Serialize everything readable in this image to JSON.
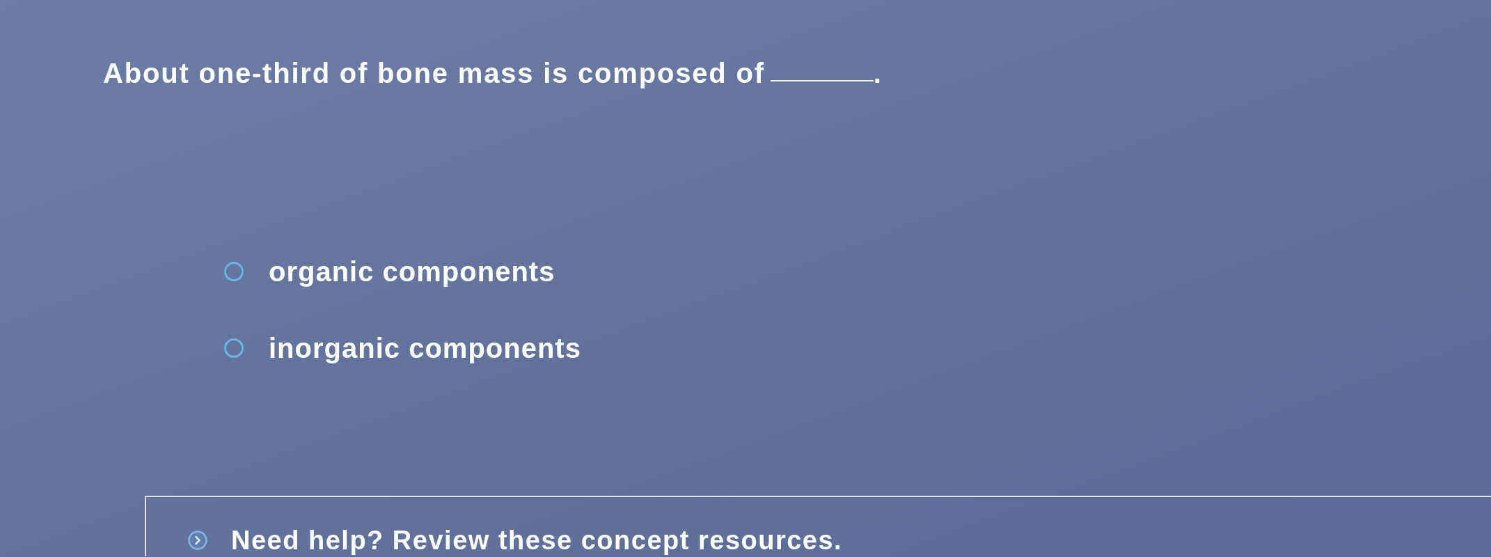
{
  "question": {
    "parts": [
      {
        "kind": "text",
        "text": "About one-third of bone mass is composed of"
      },
      {
        "kind": "blank"
      },
      {
        "kind": "text",
        "text": "."
      }
    ]
  },
  "options": [
    {
      "label": "organic components",
      "selected": false
    },
    {
      "label": "inorganic components",
      "selected": false
    }
  ],
  "help": {
    "text": "Need help? Review these concept resources.",
    "expanded": false
  }
}
